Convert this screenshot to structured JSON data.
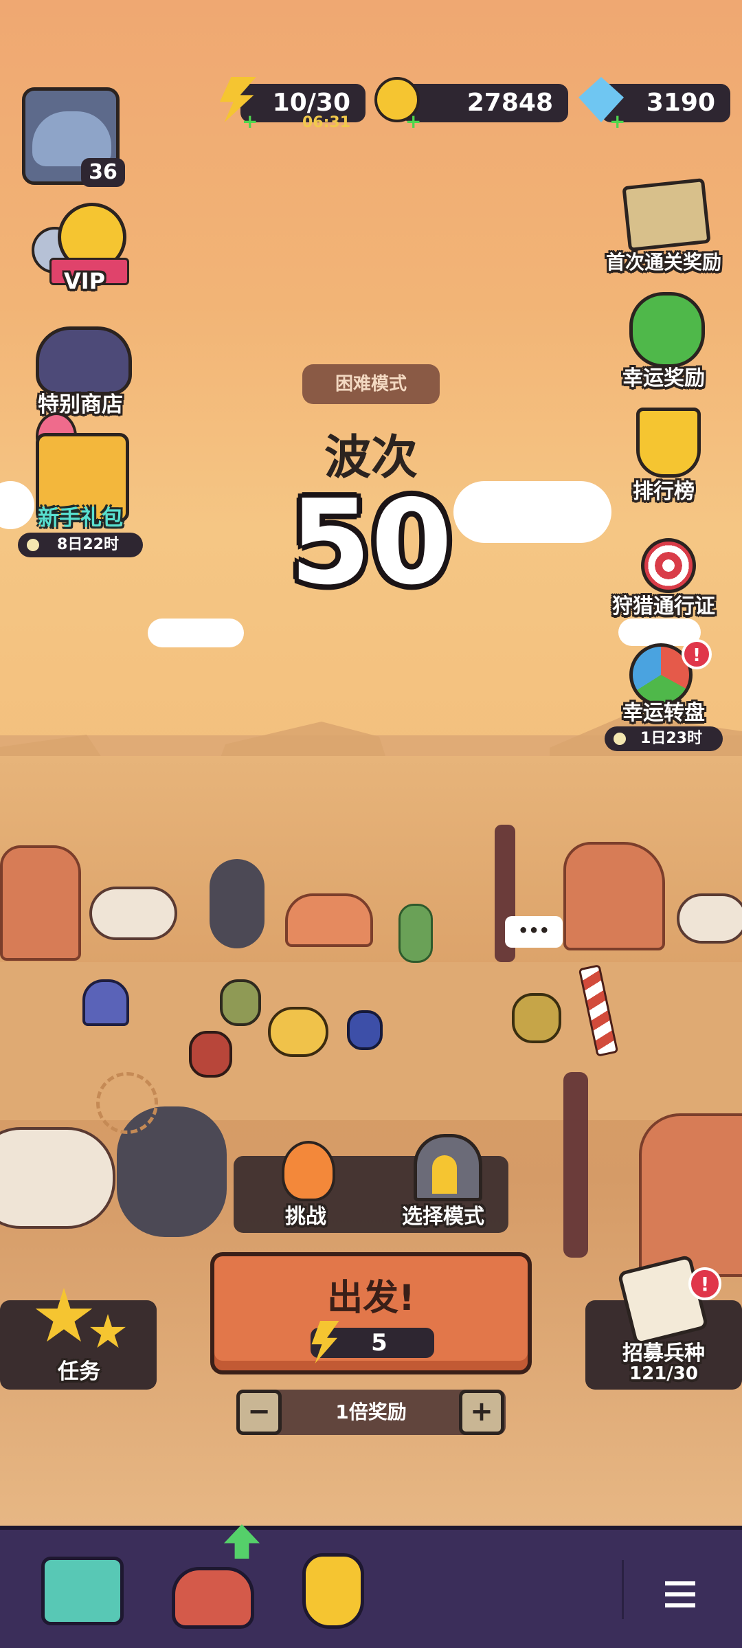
{
  "player": {
    "level": "36"
  },
  "resources": {
    "energy": {
      "value": "10/30",
      "timer": "06:31"
    },
    "gold": {
      "value": "27848"
    },
    "gems": {
      "value": "3190"
    }
  },
  "left_menu": {
    "vip_label": "VIP",
    "special_shop": "特别商店",
    "starter_pack": "新手礼包",
    "starter_pack_timer": "8日22时",
    "quests": "任务"
  },
  "right_menu": {
    "first_clear": "首次通关奖励",
    "lucky_reward": "幸运奖励",
    "leaderboard": "排行榜",
    "hunt_pass": "狩猎通行证",
    "lucky_wheel": "幸运转盘",
    "lucky_wheel_timer": "1日23时",
    "recruit": "招募兵种",
    "recruit_count": "121/30"
  },
  "stage": {
    "mode_badge": "困难模式",
    "wave_label": "波次",
    "wave_number": "50"
  },
  "speech_bubble": "•••",
  "actions": {
    "challenge": "挑战",
    "select_mode": "选择模式",
    "depart": "出发!",
    "depart_cost": "5",
    "reward_multiplier": "1倍奖励",
    "minus": "−",
    "plus": "+"
  },
  "colors": {
    "dark_panel": "#2e2631",
    "depart_orange": "#e2774a",
    "nav_purple": "#3b2e5a",
    "starter_teal": "#58e0d0"
  }
}
